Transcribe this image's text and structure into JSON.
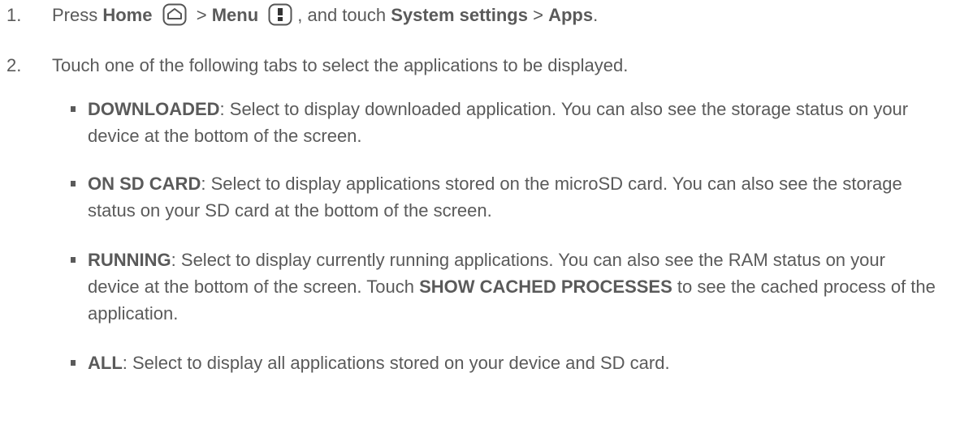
{
  "step1": {
    "number": "1.",
    "t1": "Press ",
    "home": "Home",
    "t2": " > ",
    "menu": "Menu",
    "t3": ", and touch ",
    "system_settings": "System settings",
    "t4": " > ",
    "apps": "Apps",
    "t5": ".",
    "home_icon": "home-key-icon",
    "menu_icon": "menu-key-icon"
  },
  "step2": {
    "number": "2.",
    "text": "Touch one of the following tabs to select the applications to be displayed."
  },
  "bullets": [
    {
      "term": "DOWNLOADED",
      "desc": ": Select to display downloaded application. You can also see the storage status on your device at the bottom of the screen."
    },
    {
      "term": "ON SD CARD",
      "desc": ": Select to display applications stored on the microSD card. You can also see the storage status on your SD card at the bottom of the screen."
    },
    {
      "term": "RUNNING",
      "desc_a": ": Select to display currently running applications. You can also see the RAM status on your device at the bottom of the screen. Touch ",
      "term2": "SHOW CACHED PROCESSES",
      "desc_b": " to see the cached process of the application."
    },
    {
      "term": "ALL",
      "desc": ": Select to display all applications stored on your device and SD card."
    }
  ]
}
